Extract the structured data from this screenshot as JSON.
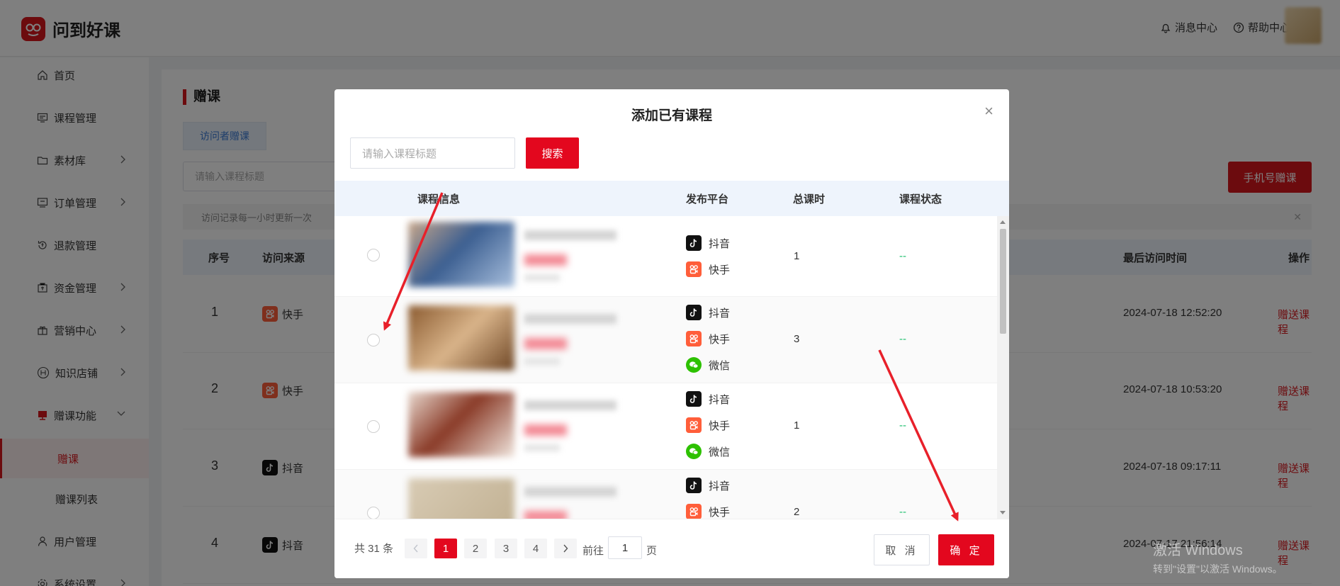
{
  "app": {
    "logo_text": "问到好课"
  },
  "header": {
    "messages": "消息中心",
    "help": "帮助中心"
  },
  "sidebar": {
    "items": [
      {
        "label": "首页"
      },
      {
        "label": "课程管理"
      },
      {
        "label": "素材库"
      },
      {
        "label": "订单管理"
      },
      {
        "label": "退款管理"
      },
      {
        "label": "资金管理"
      },
      {
        "label": "营销中心"
      },
      {
        "label": "知识店铺"
      },
      {
        "label": "赠课功能"
      },
      {
        "label": "赠课"
      },
      {
        "label": "赠课列表"
      },
      {
        "label": "用户管理"
      },
      {
        "label": "系统设置"
      }
    ]
  },
  "main": {
    "title": "赠课",
    "tab": "访问者赠课",
    "search_placeholder": "请输入课程标题",
    "phone_button": "手机号赠课",
    "notice": "访问记录每一小时更新一次",
    "columns": {
      "index": "序号",
      "source": "访问来源",
      "last_visit": "最后访问时间",
      "action": "操作"
    },
    "rows": [
      {
        "index": "1",
        "source": "快手",
        "time": "2024-07-18 12:52:20",
        "action": "赠送课程"
      },
      {
        "index": "2",
        "source": "快手",
        "time": "2024-07-18 10:53:20",
        "action": "赠送课程"
      },
      {
        "index": "3",
        "source": "抖音",
        "time": "2024-07-18 09:17:11",
        "action": "赠送课程"
      },
      {
        "index": "4",
        "source": "抖音",
        "time": "2024-07-17 21:56:14",
        "action": "赠送课程"
      }
    ]
  },
  "dialog": {
    "title": "添加已有课程",
    "search_placeholder": "请输入课程标题",
    "search_button": "搜索",
    "columns": {
      "info": "课程信息",
      "platform": "发布平台",
      "hours": "总课时",
      "status": "课程状态"
    },
    "rows": [
      {
        "platforms": [
          "抖音",
          "快手"
        ],
        "hours": "1",
        "status": "--"
      },
      {
        "platforms": [
          "抖音",
          "快手",
          "微信"
        ],
        "hours": "3",
        "status": "--"
      },
      {
        "platforms": [
          "抖音",
          "快手",
          "微信"
        ],
        "hours": "1",
        "status": "--"
      },
      {
        "platforms": [
          "抖音",
          "快手"
        ],
        "hours": "2",
        "status": "--"
      }
    ],
    "pagination": {
      "total": "共 31 条",
      "pages": [
        "1",
        "2",
        "3",
        "4"
      ],
      "current": "1",
      "goto_prefix": "前往",
      "goto_value": "1",
      "goto_suffix": "页"
    },
    "cancel": "取 消",
    "confirm": "确 定"
  },
  "watermark": {
    "line1": "激活 Windows",
    "line2": "转到\"设置\"以激活 Windows。"
  },
  "colors": {
    "brand": "#e3071e",
    "overlay": "rgba(0,0,0,0.5)",
    "status": "#19be6b",
    "annotation_arrow": "#e8202a"
  }
}
